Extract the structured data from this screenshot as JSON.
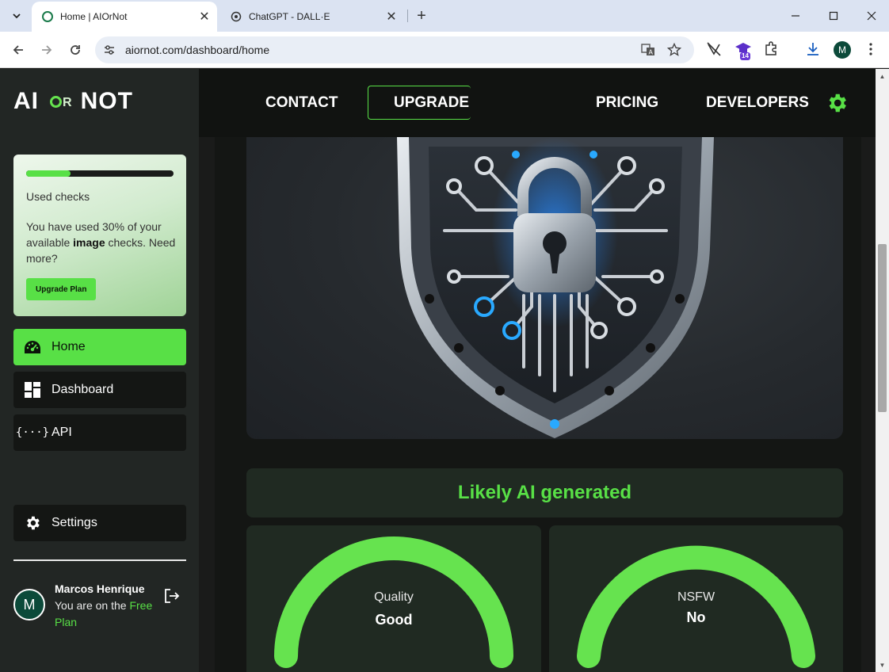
{
  "browser": {
    "tabs": [
      {
        "title": "Home | AIOrNot",
        "active": true
      },
      {
        "title": "ChatGPT - DALL·E",
        "active": false
      }
    ],
    "url": "aiornot.com/dashboard/home",
    "extension_badge": "14",
    "profile_initial": "M"
  },
  "logo": {
    "left": "AI",
    "middle": "OR",
    "right": "NOT"
  },
  "topnav": {
    "contact": "CONTACT",
    "upgrade": "UPGRADE",
    "pricing": "PRICING",
    "developers": "DEVELOPERS"
  },
  "usage": {
    "used_fraction": 0.3,
    "label": "Used checks",
    "desc_prefix": "You have used 30% of your available ",
    "desc_bold": "image",
    "desc_suffix": " checks. Need more?",
    "button": "Upgrade Plan"
  },
  "sidebar": {
    "items": [
      {
        "label": "Home",
        "icon": "gauge-icon",
        "active": true
      },
      {
        "label": "Dashboard",
        "icon": "dashboard-icon",
        "active": false
      },
      {
        "label": "API",
        "icon": "code-braces-icon",
        "active": false
      }
    ],
    "settings": "Settings"
  },
  "user": {
    "initial": "M",
    "name": "Marcos Henrique",
    "plan_prefix": "You are on the ",
    "plan_name": "Free Plan"
  },
  "result": {
    "verdict": "Likely AI generated"
  },
  "gauges": [
    {
      "label": "Quality",
      "value": "Good"
    },
    {
      "label": "NSFW",
      "value": "No"
    }
  ],
  "colors": {
    "accent": "#58e046",
    "sidebar_bg": "#222624",
    "card_bg": "#202a22"
  }
}
